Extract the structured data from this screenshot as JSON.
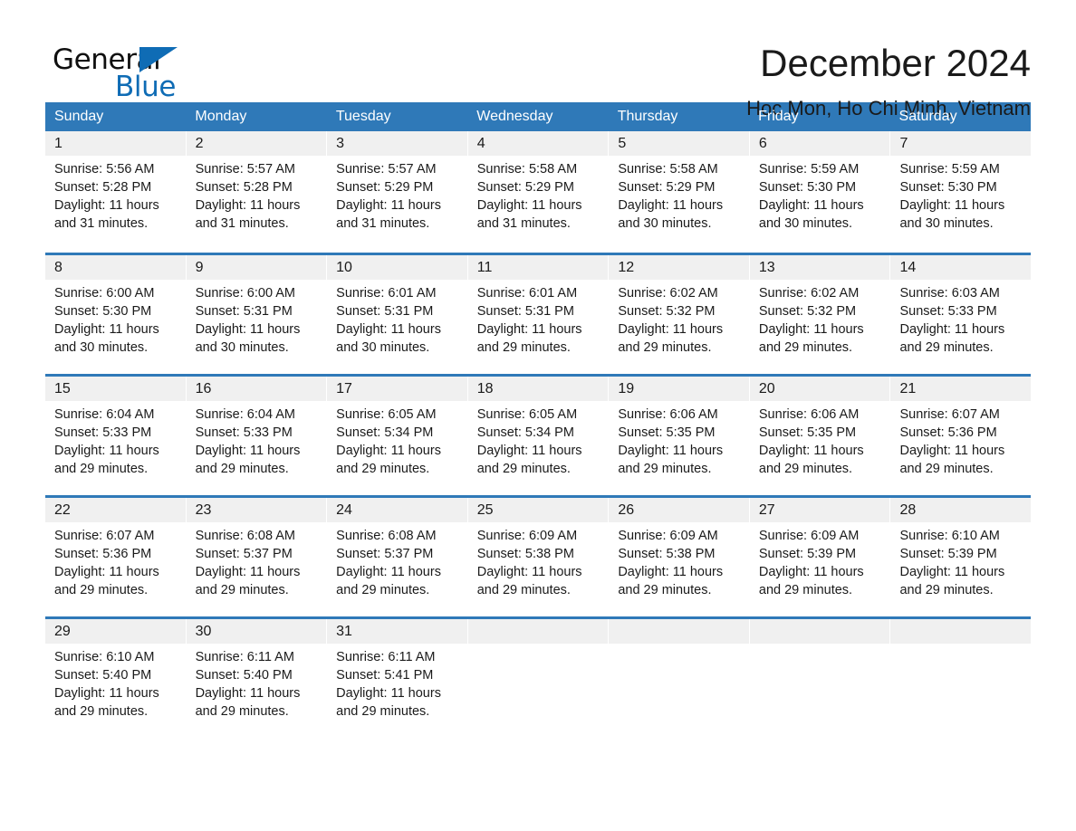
{
  "brand": {
    "name_part1": "General",
    "name_part2": "Blue",
    "accent_color": "#0f6cb5"
  },
  "header": {
    "title": "December 2024",
    "location": "Hoc Mon, Ho Chi Minh, Vietnam",
    "header_bg_color": "#2f79b8",
    "daynum_bg_color": "#f0f0f0"
  },
  "weekdays": [
    "Sunday",
    "Monday",
    "Tuesday",
    "Wednesday",
    "Thursday",
    "Friday",
    "Saturday"
  ],
  "weeks": [
    [
      {
        "day": "1",
        "sunrise": "Sunrise: 5:56 AM",
        "sunset": "Sunset: 5:28 PM",
        "daylight1": "Daylight: 11 hours",
        "daylight2": "and 31 minutes."
      },
      {
        "day": "2",
        "sunrise": "Sunrise: 5:57 AM",
        "sunset": "Sunset: 5:28 PM",
        "daylight1": "Daylight: 11 hours",
        "daylight2": "and 31 minutes."
      },
      {
        "day": "3",
        "sunrise": "Sunrise: 5:57 AM",
        "sunset": "Sunset: 5:29 PM",
        "daylight1": "Daylight: 11 hours",
        "daylight2": "and 31 minutes."
      },
      {
        "day": "4",
        "sunrise": "Sunrise: 5:58 AM",
        "sunset": "Sunset: 5:29 PM",
        "daylight1": "Daylight: 11 hours",
        "daylight2": "and 31 minutes."
      },
      {
        "day": "5",
        "sunrise": "Sunrise: 5:58 AM",
        "sunset": "Sunset: 5:29 PM",
        "daylight1": "Daylight: 11 hours",
        "daylight2": "and 30 minutes."
      },
      {
        "day": "6",
        "sunrise": "Sunrise: 5:59 AM",
        "sunset": "Sunset: 5:30 PM",
        "daylight1": "Daylight: 11 hours",
        "daylight2": "and 30 minutes."
      },
      {
        "day": "7",
        "sunrise": "Sunrise: 5:59 AM",
        "sunset": "Sunset: 5:30 PM",
        "daylight1": "Daylight: 11 hours",
        "daylight2": "and 30 minutes."
      }
    ],
    [
      {
        "day": "8",
        "sunrise": "Sunrise: 6:00 AM",
        "sunset": "Sunset: 5:30 PM",
        "daylight1": "Daylight: 11 hours",
        "daylight2": "and 30 minutes."
      },
      {
        "day": "9",
        "sunrise": "Sunrise: 6:00 AM",
        "sunset": "Sunset: 5:31 PM",
        "daylight1": "Daylight: 11 hours",
        "daylight2": "and 30 minutes."
      },
      {
        "day": "10",
        "sunrise": "Sunrise: 6:01 AM",
        "sunset": "Sunset: 5:31 PM",
        "daylight1": "Daylight: 11 hours",
        "daylight2": "and 30 minutes."
      },
      {
        "day": "11",
        "sunrise": "Sunrise: 6:01 AM",
        "sunset": "Sunset: 5:31 PM",
        "daylight1": "Daylight: 11 hours",
        "daylight2": "and 29 minutes."
      },
      {
        "day": "12",
        "sunrise": "Sunrise: 6:02 AM",
        "sunset": "Sunset: 5:32 PM",
        "daylight1": "Daylight: 11 hours",
        "daylight2": "and 29 minutes."
      },
      {
        "day": "13",
        "sunrise": "Sunrise: 6:02 AM",
        "sunset": "Sunset: 5:32 PM",
        "daylight1": "Daylight: 11 hours",
        "daylight2": "and 29 minutes."
      },
      {
        "day": "14",
        "sunrise": "Sunrise: 6:03 AM",
        "sunset": "Sunset: 5:33 PM",
        "daylight1": "Daylight: 11 hours",
        "daylight2": "and 29 minutes."
      }
    ],
    [
      {
        "day": "15",
        "sunrise": "Sunrise: 6:04 AM",
        "sunset": "Sunset: 5:33 PM",
        "daylight1": "Daylight: 11 hours",
        "daylight2": "and 29 minutes."
      },
      {
        "day": "16",
        "sunrise": "Sunrise: 6:04 AM",
        "sunset": "Sunset: 5:33 PM",
        "daylight1": "Daylight: 11 hours",
        "daylight2": "and 29 minutes."
      },
      {
        "day": "17",
        "sunrise": "Sunrise: 6:05 AM",
        "sunset": "Sunset: 5:34 PM",
        "daylight1": "Daylight: 11 hours",
        "daylight2": "and 29 minutes."
      },
      {
        "day": "18",
        "sunrise": "Sunrise: 6:05 AM",
        "sunset": "Sunset: 5:34 PM",
        "daylight1": "Daylight: 11 hours",
        "daylight2": "and 29 minutes."
      },
      {
        "day": "19",
        "sunrise": "Sunrise: 6:06 AM",
        "sunset": "Sunset: 5:35 PM",
        "daylight1": "Daylight: 11 hours",
        "daylight2": "and 29 minutes."
      },
      {
        "day": "20",
        "sunrise": "Sunrise: 6:06 AM",
        "sunset": "Sunset: 5:35 PM",
        "daylight1": "Daylight: 11 hours",
        "daylight2": "and 29 minutes."
      },
      {
        "day": "21",
        "sunrise": "Sunrise: 6:07 AM",
        "sunset": "Sunset: 5:36 PM",
        "daylight1": "Daylight: 11 hours",
        "daylight2": "and 29 minutes."
      }
    ],
    [
      {
        "day": "22",
        "sunrise": "Sunrise: 6:07 AM",
        "sunset": "Sunset: 5:36 PM",
        "daylight1": "Daylight: 11 hours",
        "daylight2": "and 29 minutes."
      },
      {
        "day": "23",
        "sunrise": "Sunrise: 6:08 AM",
        "sunset": "Sunset: 5:37 PM",
        "daylight1": "Daylight: 11 hours",
        "daylight2": "and 29 minutes."
      },
      {
        "day": "24",
        "sunrise": "Sunrise: 6:08 AM",
        "sunset": "Sunset: 5:37 PM",
        "daylight1": "Daylight: 11 hours",
        "daylight2": "and 29 minutes."
      },
      {
        "day": "25",
        "sunrise": "Sunrise: 6:09 AM",
        "sunset": "Sunset: 5:38 PM",
        "daylight1": "Daylight: 11 hours",
        "daylight2": "and 29 minutes."
      },
      {
        "day": "26",
        "sunrise": "Sunrise: 6:09 AM",
        "sunset": "Sunset: 5:38 PM",
        "daylight1": "Daylight: 11 hours",
        "daylight2": "and 29 minutes."
      },
      {
        "day": "27",
        "sunrise": "Sunrise: 6:09 AM",
        "sunset": "Sunset: 5:39 PM",
        "daylight1": "Daylight: 11 hours",
        "daylight2": "and 29 minutes."
      },
      {
        "day": "28",
        "sunrise": "Sunrise: 6:10 AM",
        "sunset": "Sunset: 5:39 PM",
        "daylight1": "Daylight: 11 hours",
        "daylight2": "and 29 minutes."
      }
    ],
    [
      {
        "day": "29",
        "sunrise": "Sunrise: 6:10 AM",
        "sunset": "Sunset: 5:40 PM",
        "daylight1": "Daylight: 11 hours",
        "daylight2": "and 29 minutes."
      },
      {
        "day": "30",
        "sunrise": "Sunrise: 6:11 AM",
        "sunset": "Sunset: 5:40 PM",
        "daylight1": "Daylight: 11 hours",
        "daylight2": "and 29 minutes."
      },
      {
        "day": "31",
        "sunrise": "Sunrise: 6:11 AM",
        "sunset": "Sunset: 5:41 PM",
        "daylight1": "Daylight: 11 hours",
        "daylight2": "and 29 minutes."
      },
      {
        "day": "",
        "sunrise": "",
        "sunset": "",
        "daylight1": "",
        "daylight2": ""
      },
      {
        "day": "",
        "sunrise": "",
        "sunset": "",
        "daylight1": "",
        "daylight2": ""
      },
      {
        "day": "",
        "sunrise": "",
        "sunset": "",
        "daylight1": "",
        "daylight2": ""
      },
      {
        "day": "",
        "sunrise": "",
        "sunset": "",
        "daylight1": "",
        "daylight2": ""
      }
    ]
  ]
}
